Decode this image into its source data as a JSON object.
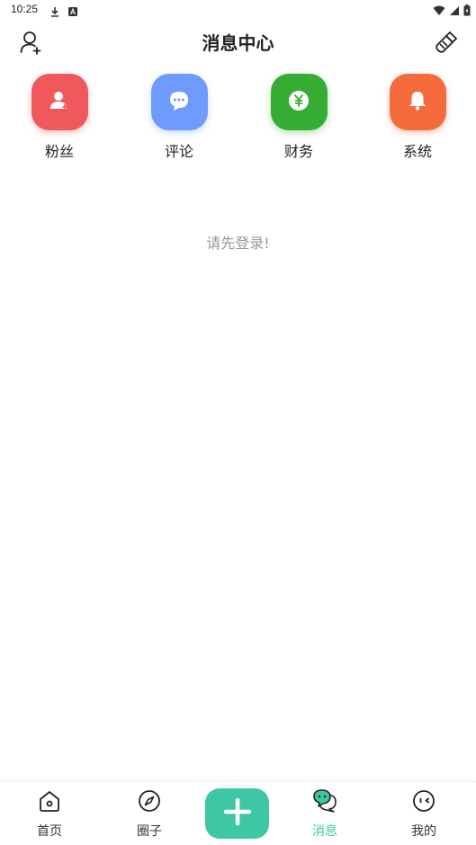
{
  "status_bar": {
    "time": "10:25"
  },
  "header": {
    "title": "消息中心"
  },
  "categories": [
    {
      "label": "粉丝",
      "color": "#f0585c",
      "icon": "user-plus-icon"
    },
    {
      "label": "评论",
      "color": "#6f9bff",
      "icon": "chat-bubble-icon"
    },
    {
      "label": "财务",
      "color": "#35ad34",
      "icon": "yen-icon"
    },
    {
      "label": "系统",
      "color": "#f56b3c",
      "icon": "bell-icon"
    }
  ],
  "main": {
    "login_hint": "请先登录!"
  },
  "tabbar": {
    "accent": "#3ec7a4",
    "items": [
      {
        "label": "首页",
        "icon": "home-icon"
      },
      {
        "label": "圈子",
        "icon": "compass-icon"
      },
      {
        "label": "消息",
        "icon": "message-icon",
        "active": true
      },
      {
        "label": "我的",
        "icon": "profile-face-icon"
      }
    ],
    "center_icon": "plus-icon"
  }
}
